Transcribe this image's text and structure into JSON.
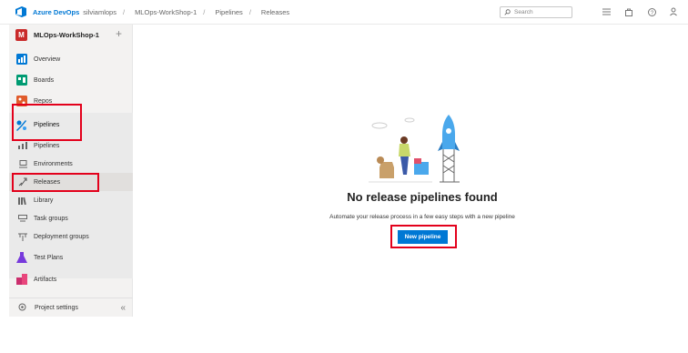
{
  "topbar": {
    "brand": "Azure DevOps",
    "breadcrumb": [
      "silviamlops",
      "MLOps-WorkShop-1",
      "Pipelines",
      "Releases"
    ],
    "separator": "/",
    "search_placeholder": "Search",
    "icons": [
      "list-icon",
      "bag-icon",
      "help-icon",
      "user-settings-icon"
    ]
  },
  "sidebar": {
    "project_initial": "M",
    "project_name": "MLOps-WorkShop-1",
    "add_symbol": "+",
    "items": [
      {
        "label": "Overview",
        "icon": "overview-icon"
      },
      {
        "label": "Boards",
        "icon": "boards-icon"
      },
      {
        "label": "Repos",
        "icon": "repos-icon"
      },
      {
        "label": "Pipelines",
        "icon": "pipelines-icon"
      },
      {
        "label": "Pipelines",
        "icon": "pipelines-sub-icon"
      },
      {
        "label": "Environments",
        "icon": "environments-icon"
      },
      {
        "label": "Releases",
        "icon": "releases-icon"
      },
      {
        "label": "Library",
        "icon": "library-icon"
      },
      {
        "label": "Task groups",
        "icon": "task-groups-icon"
      },
      {
        "label": "Deployment groups",
        "icon": "deployment-groups-icon"
      },
      {
        "label": "Test Plans",
        "icon": "test-plans-icon"
      },
      {
        "label": "Artifacts",
        "icon": "artifacts-icon"
      }
    ],
    "settings_label": "Project settings",
    "collapse_symbol": "«"
  },
  "main": {
    "title": "No release pipelines found",
    "description": "Automate your release process in a few easy steps with a new pipeline",
    "button": "New pipeline"
  },
  "colors": {
    "accent": "#0078d4",
    "highlight": "#e3001b",
    "project_badge": "#c92a2a"
  }
}
